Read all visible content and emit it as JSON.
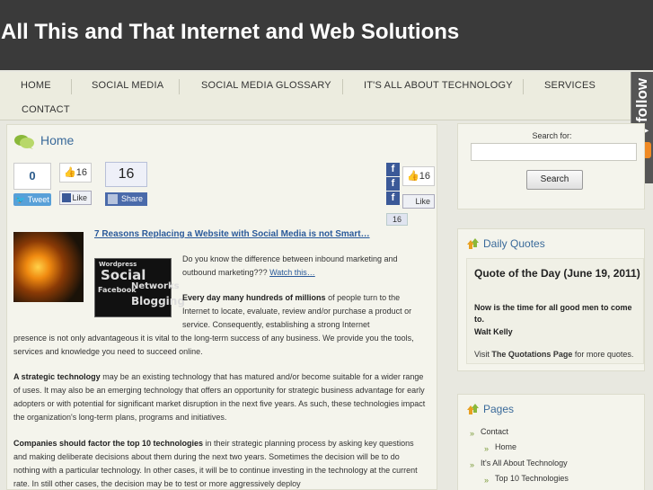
{
  "site": {
    "title": "All This and That Internet and Web Solutions"
  },
  "nav": {
    "items": [
      "HOME",
      "SOCIAL MEDIA",
      "SOCIAL MEDIA GLOSSARY",
      "IT'S ALL ABOUT TECHNOLOGY",
      "SERVICES",
      "CONTACT"
    ]
  },
  "follow": {
    "label": "follow"
  },
  "main": {
    "title": "Home",
    "share": {
      "tweet_count": "0",
      "tweet_label": "Tweet",
      "like_count": "16",
      "like_label": "Like",
      "share_count": "16",
      "share_label": "Share",
      "widget_like_count": "16",
      "widget_like_label": "Like",
      "widget_share_count": "16"
    },
    "article_link": "7 Reasons Replacing a Website with Social Media is not Smart…",
    "thumb_words": [
      "Wordpress",
      "Social",
      "Networks",
      "Facebook",
      "Blogging"
    ],
    "p1_text": "Do you know the difference between inbound marketing and outbound marketing???",
    "p1_link": "Watch this…",
    "p2_bold": "Every day many hundreds of millions",
    "p2_rest1": "of people turn to the Internet to locate, evaluate, review and/or purchase a product or service. Consequently, establishing a strong Internet",
    "p2_rest2": "presence is not only advantageous it is vital to the long-term success of any business. We provide you the tools, services and knowledge you need to succeed online.",
    "p3_bold": "A strategic technology",
    "p3_rest": "may be an existing technology that has matured and/or become suitable for a wider range of uses. It may also be an emerging technology that offers an opportunity for strategic business advantage for early adopters or with potential for significant market disruption in the next five years. As such, these technologies impact the organization's long-term plans, programs and initiatives.",
    "p4_bold": "Companies should factor the top 10 technologies",
    "p4_rest": "in their strategic planning process by asking key questions and making deliberate decisions about them during the next two years. Sometimes the decision will be to do nothing with a particular technology. In other cases, it will be to continue investing in the technology at the current rate. In still other cases, the decision may be to test or more aggressively deploy"
  },
  "search": {
    "label": "Search for:",
    "value": "",
    "button": "Search"
  },
  "quotes": {
    "title": "Daily Quotes",
    "quote_title": "Quote of the Day (June 19, 2011)",
    "quote": "Now is the time for all good men to come to.",
    "author": "Walt Kelly",
    "visit_prefix": "Visit",
    "visit_link": "The Quotations Page",
    "visit_suffix": "for more quotes."
  },
  "pages": {
    "title": "Pages",
    "items": [
      "Contact",
      "Home",
      "It's All About Technology",
      "Top 10 Technologies"
    ]
  },
  "colors": {
    "header_bg": "#3a3a3a",
    "link": "#2a5a9a",
    "title_blue": "#3a6a9a",
    "facebook": "#3b5998",
    "twitter": "#58a0d8",
    "rss": "#f08a24"
  }
}
